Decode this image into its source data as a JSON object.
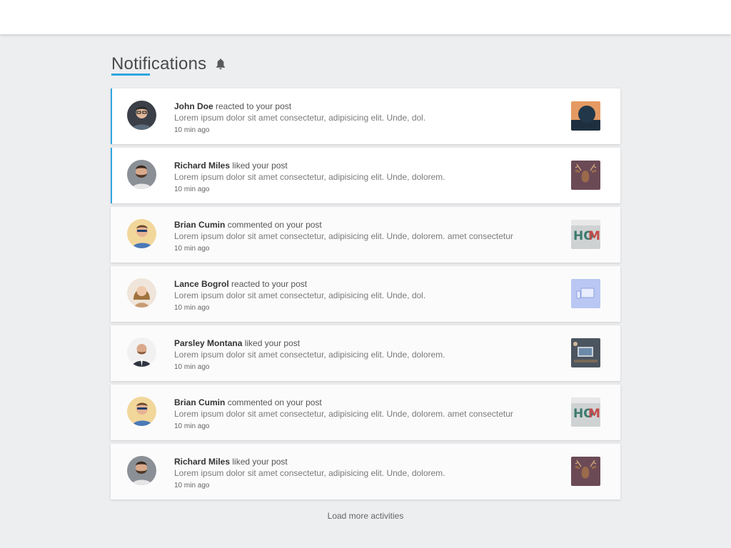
{
  "header": {
    "title": "Notifications",
    "icon": "bell-icon"
  },
  "colors": {
    "accent": "#2ea7e0",
    "background": "#edeef0"
  },
  "notifications": [
    {
      "name": "John Doe",
      "action": "reacted to your post",
      "message": "Lorem ipsum dolor sit amet consectetur, adipisicing elit. Unde, dol.",
      "time": "10 min ago",
      "unread": true,
      "avatar": "man-glasses-avatar",
      "thumbnail": "sunset-moon-thumbnail"
    },
    {
      "name": "Richard Miles",
      "action": "liked your post",
      "message": "Lorem ipsum dolor sit amet consectetur, adipisicing elit. Unde, dolorem.",
      "time": "10 min ago",
      "unread": true,
      "avatar": "bearded-man-avatar",
      "thumbnail": "deer-thumbnail"
    },
    {
      "name": "Brian Cumin",
      "action": "commented on your post",
      "message": "Lorem ipsum dolor sit amet consectetur, adipisicing elit. Unde, dolorem.  amet consectetur",
      "time": "10 min ago",
      "unread": false,
      "avatar": "sunglasses-man-avatar",
      "thumbnail": "home-sign-thumbnail"
    },
    {
      "name": "Lance Bogrol",
      "action": "reacted to your post",
      "message": "Lorem ipsum dolor sit amet consectetur, adipisicing elit. Unde, dol.",
      "time": "10 min ago",
      "unread": false,
      "avatar": "woman-avatar",
      "thumbnail": "devices-thumbnail"
    },
    {
      "name": "Parsley Montana",
      "action": "liked your post",
      "message": "Lorem ipsum dolor sit amet consectetur, adipisicing elit. Unde, dolorem.",
      "time": "10 min ago",
      "unread": false,
      "avatar": "suited-man-avatar",
      "thumbnail": "desk-thumbnail"
    },
    {
      "name": "Brian Cumin",
      "action": "commented on your post",
      "message": "Lorem ipsum dolor sit amet consectetur, adipisicing elit. Unde, dolorem. amet consectetur",
      "time": "10 min ago",
      "unread": false,
      "avatar": "sunglasses-man-avatar",
      "thumbnail": "home-sign-thumbnail"
    },
    {
      "name": "Richard Miles",
      "action": "liked your post",
      "message": "Lorem ipsum dolor sit amet consectetur, adipisicing elit. Unde, dolorem.",
      "time": "10 min ago",
      "unread": false,
      "avatar": "bearded-man-avatar",
      "thumbnail": "deer-thumbnail"
    }
  ],
  "footer": {
    "load_more": "Load more activities"
  }
}
